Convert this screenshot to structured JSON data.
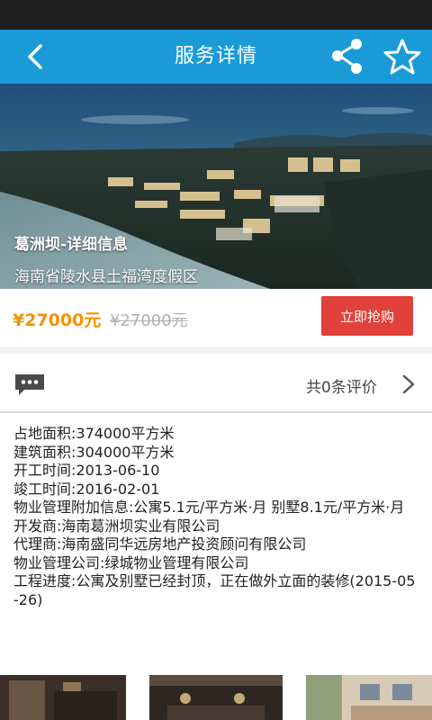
{
  "nav": {
    "title": "服务详情",
    "back_icon": "chevron-left-icon",
    "share_icon": "share-icon",
    "favorite_icon": "star-outline-icon",
    "bar_color": "#1a9bd8"
  },
  "hero": {
    "caption": "葛洲坝-详细信息",
    "address": "海南省陵水县土福湾度假区"
  },
  "price": {
    "current": "¥27000元",
    "original": "¥27000元",
    "buy_label": "立即抢购",
    "current_color": "#f39200",
    "buy_color": "#e0413a"
  },
  "reviews": {
    "icon": "comment-icon",
    "count_text": "共0条评价",
    "chevron_icon": "chevron-right-icon"
  },
  "details": [
    "占地面积:374000平方米",
    "建筑面积:304000平方米",
    "开工时间:2013-06-10",
    "竣工时间:2016-02-01",
    "物业管理附加信息:公寓5.1元/平方米·月 别墅8.1元/平方米·月",
    "开发商:海南葛洲坝实业有限公司",
    "代理商:海南盛同华远房地产投资顾问有限公司",
    "物业管理公司:绿城物业管理有限公司",
    "工程进度:公寓及别墅已经封顶，正在做外立面的装修(2015-05-26)"
  ]
}
